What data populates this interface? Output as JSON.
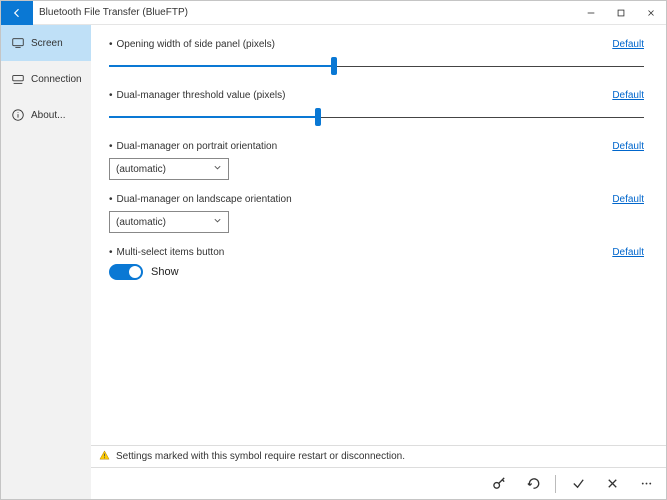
{
  "window": {
    "title": "Bluetooth File Transfer (BlueFTP)"
  },
  "sidebar": {
    "items": [
      {
        "label": "Screen"
      },
      {
        "label": "Connection"
      },
      {
        "label": "About..."
      }
    ]
  },
  "settings": {
    "opening_width": {
      "label": "Opening width of side panel (pixels)",
      "default_link": "Default",
      "percent": 42
    },
    "dual_threshold": {
      "label": "Dual-manager threshold value (pixels)",
      "default_link": "Default",
      "percent": 39
    },
    "portrait": {
      "label": "Dual-manager on portrait orientation",
      "default_link": "Default",
      "value": "(automatic)"
    },
    "landscape": {
      "label": "Dual-manager on landscape orientation",
      "default_link": "Default",
      "value": "(automatic)"
    },
    "multiselect": {
      "label": "Multi-select items button",
      "default_link": "Default",
      "toggle_label": "Show",
      "on": true
    }
  },
  "footer": {
    "warning": "Settings marked with this symbol require restart or disconnection."
  }
}
